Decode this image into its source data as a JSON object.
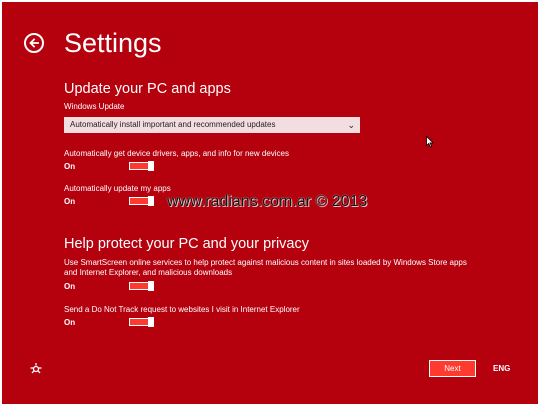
{
  "colors": {
    "background": "#b5000e",
    "accent": "#ff3b2f",
    "text": "#ffffff"
  },
  "header": {
    "title": "Settings",
    "back_icon": "back-arrow-icon"
  },
  "update_section": {
    "heading": "Update your PC and apps",
    "windows_update_label": "Windows Update",
    "windows_update_value": "Automatically install important and recommended updates",
    "drivers_label": "Automatically get device drivers, apps, and info for new devices",
    "drivers_state": "On",
    "drivers_on": true,
    "apps_label": "Automatically update my apps",
    "apps_state": "On",
    "apps_on": true
  },
  "privacy_section": {
    "heading": "Help protect your PC and your privacy",
    "smartscreen_label_line1": "Use SmartScreen online services to help protect against malicious content in sites loaded by Windows Store apps",
    "smartscreen_label_line2": "and Internet Explorer, and malicious downloads",
    "smartscreen_state": "On",
    "smartscreen_on": true,
    "dnt_label": "Send a Do Not Track request to websites I visit in Internet Explorer",
    "dnt_state": "On",
    "dnt_on": true
  },
  "watermark": "www.radians.com.ar © 2013",
  "footer": {
    "ease_icon": "ease-of-access-icon",
    "next_label": "Next",
    "language": "ENG"
  }
}
